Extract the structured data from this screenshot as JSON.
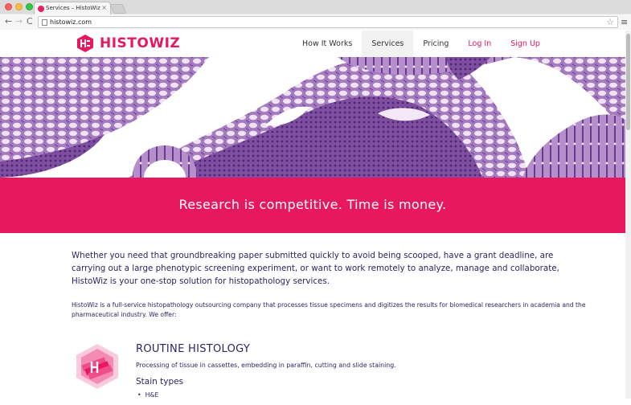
{
  "browser": {
    "tab_title": "Services – HistoWiz",
    "tab_close": "×",
    "url": "histowiz.com",
    "back_glyph": "←",
    "forward_glyph": "→",
    "reload_glyph": "C",
    "star_glyph": "☆",
    "menu_glyph": "≡"
  },
  "site": {
    "logo_text": "HISTOWIZ",
    "brand_color": "#e8185e",
    "nav": [
      {
        "label": "How It Works",
        "style": "normal"
      },
      {
        "label": "Services",
        "style": "active"
      },
      {
        "label": "Pricing",
        "style": "normal"
      },
      {
        "label": "Log In",
        "style": "pink"
      },
      {
        "label": "Sign Up",
        "style": "pink"
      }
    ]
  },
  "banner": {
    "text": "Research is competitive. Time is money."
  },
  "content": {
    "lead": "Whether you need that groundbreaking paper submitted quickly to avoid being scooped, have a grant deadline, are carrying out a large phenotypic screening experiment, or want to work remotely to analyze, manage and collaborate, HistoWiz is your one-stop solution for histopathology services.",
    "intro": "HistoWiz is a full-service histopathology outsourcing company that processes tissue specimens and digitizes the results for biomedical researchers in academia and the pharmaceutical industry. We offer:",
    "service": {
      "title": "ROUTINE HISTOLOGY",
      "description": "Processing of tissue in cassettes, embedding in paraffin, cutting and slide staining.",
      "stain_title": "Stain types",
      "stains": [
        "H&E"
      ]
    }
  }
}
